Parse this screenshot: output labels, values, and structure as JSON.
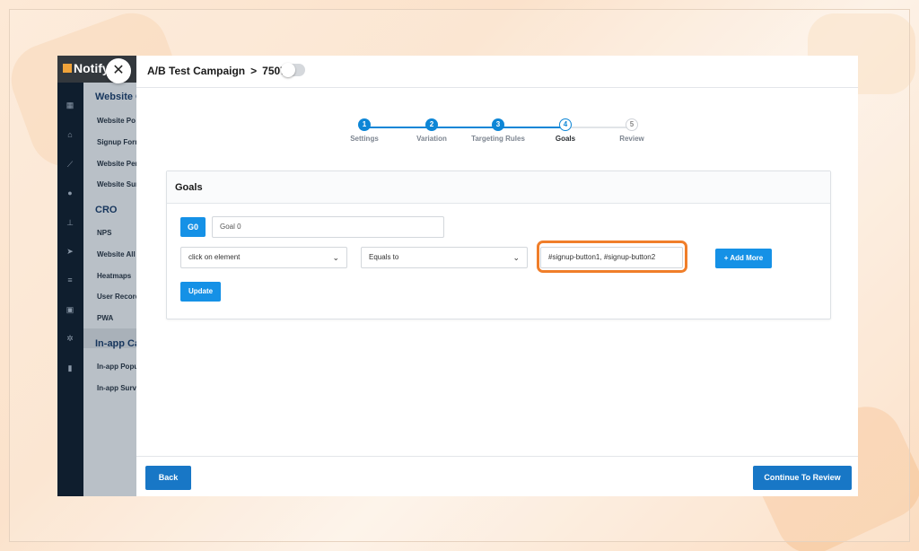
{
  "colors": {
    "accent": "#0d86d6",
    "highlight": "#f07e2a",
    "sidebar_dark": "#0f1e2e"
  },
  "app": {
    "logo_text": "Notify",
    "menu": {
      "section_website": "Website C",
      "items_website": [
        "Website Po",
        "Signup Form",
        "Website Per",
        "Website Sur"
      ],
      "section_cro": "CRO",
      "items_cro": [
        "NPS",
        "Website All",
        "Heatmaps",
        "User Record",
        "PWA"
      ],
      "section_inapp": "In-app Car",
      "items_inapp": [
        "In-app Popu",
        "In-app Surve"
      ]
    }
  },
  "modal": {
    "breadcrumb_parent": "A/B Test Campaign",
    "breadcrumb_sep": ">",
    "breadcrumb_current": "7507",
    "steps": [
      {
        "num": "1",
        "label": "Settings"
      },
      {
        "num": "2",
        "label": "Variation"
      },
      {
        "num": "3",
        "label": "Targeting Rules"
      },
      {
        "num": "4",
        "label": "Goals"
      },
      {
        "num": "5",
        "label": "Review"
      }
    ],
    "panel_title": "Goals",
    "goal_badge": "G0",
    "goal_name_value": "Goal 0",
    "event_select_value": "click on element",
    "operator_select_value": "Equals to",
    "condition_value": "#signup-button1, #signup-button2",
    "add_more_label": "+ Add More",
    "update_label": "Update",
    "back_label": "Back",
    "continue_label": "Continue To Review"
  }
}
